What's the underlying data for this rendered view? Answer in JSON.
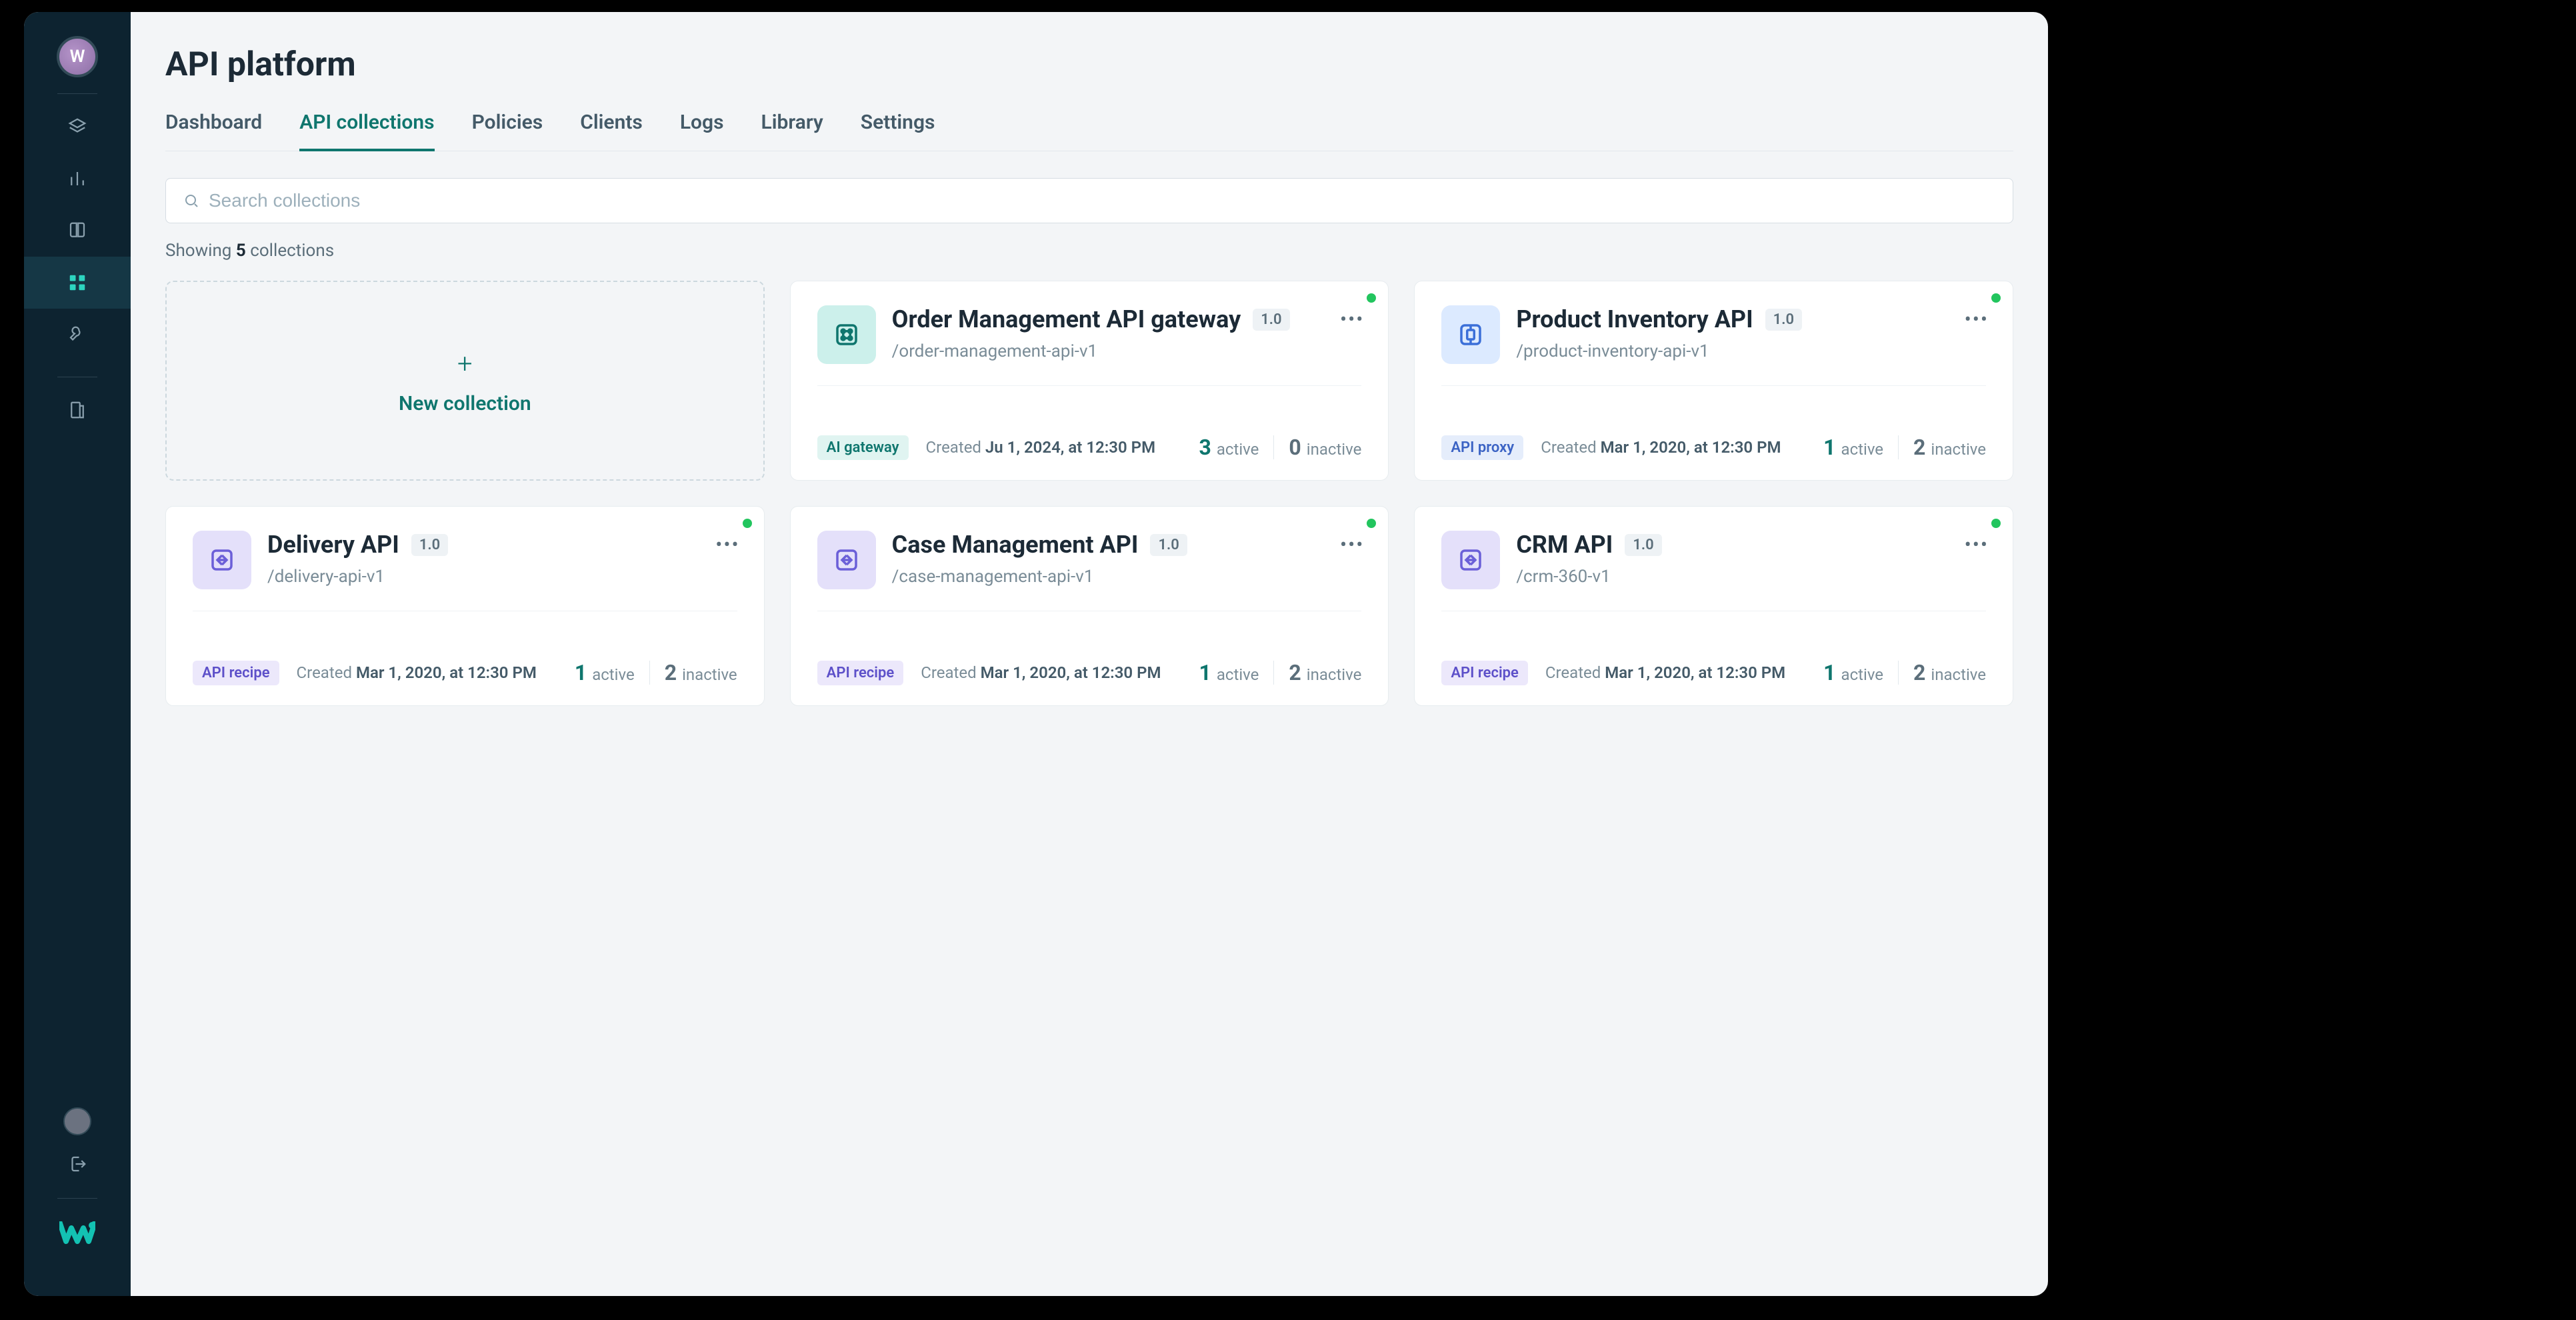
{
  "avatar_initial": "W",
  "page_title": "API platform",
  "tabs": [
    {
      "label": "Dashboard",
      "active": false
    },
    {
      "label": "API collections",
      "active": true
    },
    {
      "label": "Policies",
      "active": false
    },
    {
      "label": "Clients",
      "active": false
    },
    {
      "label": "Logs",
      "active": false
    },
    {
      "label": "Library",
      "active": false
    },
    {
      "label": "Settings",
      "active": false
    }
  ],
  "search_placeholder": "Search collections",
  "result_prefix": "Showing ",
  "result_count": "5",
  "result_suffix": " collections",
  "new_collection_label": "New collection",
  "created_label": "Created ",
  "active_label": "active",
  "inactive_label": "inactive",
  "cards": [
    {
      "title": "Order Management API gateway",
      "version": "1.0",
      "path": "/order-management-api-v1",
      "tag": "AI gateway",
      "tag_color": "teal",
      "icon_color": "teal",
      "created_date": "Ju 1, 2024, at 12:30 PM",
      "active": "3",
      "inactive": "0"
    },
    {
      "title": "Product Inventory API",
      "version": "1.0",
      "path": "/product-inventory-api-v1",
      "tag": "API proxy",
      "tag_color": "blue",
      "icon_color": "blue",
      "created_date": "Mar 1, 2020, at 12:30 PM",
      "active": "1",
      "inactive": "2"
    },
    {
      "title": "Delivery API",
      "version": "1.0",
      "path": "/delivery-api-v1",
      "tag": "API recipe",
      "tag_color": "violet",
      "icon_color": "violet",
      "created_date": "Mar 1, 2020, at 12:30 PM",
      "active": "1",
      "inactive": "2"
    },
    {
      "title": "Case Management API",
      "version": "1.0",
      "path": "/case-management-api-v1",
      "tag": "API recipe",
      "tag_color": "violet",
      "icon_color": "violet",
      "created_date": "Mar 1, 2020, at 12:30 PM",
      "active": "1",
      "inactive": "2"
    },
    {
      "title": "CRM API",
      "version": "1.0",
      "path": "/crm-360-v1",
      "tag": "API recipe",
      "tag_color": "violet",
      "icon_color": "violet",
      "created_date": "Mar 1, 2020, at 12:30 PM",
      "active": "1",
      "inactive": "2"
    }
  ]
}
